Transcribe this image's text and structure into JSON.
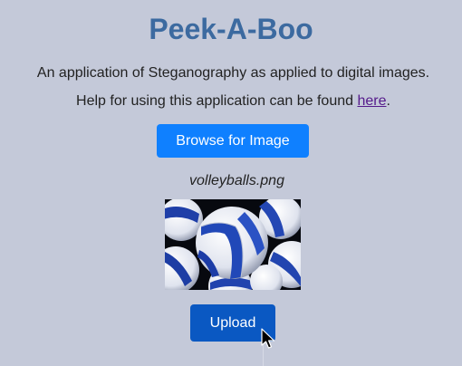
{
  "app": {
    "title": "Peek-A-Boo",
    "subtitle": "An application of Steganography as applied to digital images.",
    "help_prefix": "Help for using this application can be found ",
    "help_link": "here",
    "help_suffix": "."
  },
  "browse": {
    "label": "Browse for Image"
  },
  "selected_file": {
    "name": "volleyballs.png"
  },
  "upload": {
    "label": "Upload"
  },
  "colors": {
    "background": "#c4c9d9",
    "title": "#3c6aa0",
    "browse_button": "#0f80ff",
    "upload_button": "#0a58c2",
    "link": "#551a8b"
  }
}
